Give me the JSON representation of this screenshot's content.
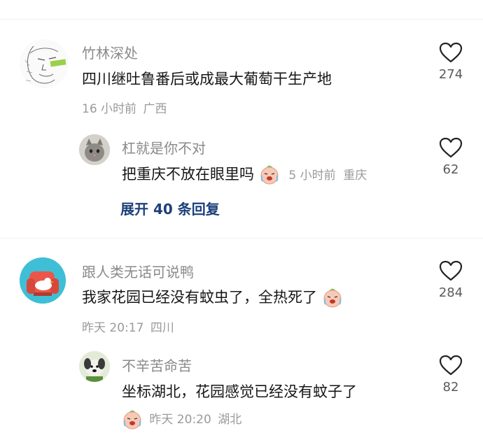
{
  "comments": [
    {
      "user": "竹林深处",
      "text": "四川继吐鲁番后或成最大葡萄干生产地",
      "time": "16 小时前",
      "location": "广西",
      "likes": "274",
      "avatar": "sketch-face-avatar",
      "reply": {
        "user": "杠就是你不对",
        "text": "把重庆不放在眼里吗",
        "emoji": "crying-face-emoji",
        "time": "5 小时前",
        "location": "重庆",
        "likes": "62",
        "avatar": "cat-avatar"
      },
      "expand_label": "展开 40 条回复"
    },
    {
      "user": "跟人类无话可说鸭",
      "text": "我家花园已经没有蚊虫了，全热死了",
      "emoji": "crying-face-emoji",
      "time": "昨天 20:17",
      "location": "四川",
      "likes": "284",
      "avatar": "duck-on-armchair-avatar",
      "reply": {
        "user": "不辛苦命苦",
        "text": "坐标湖北，花园感觉已经没有蚊子了",
        "emoji": "crying-face-emoji",
        "time": "昨天 20:20",
        "location": "湖北",
        "likes": "82",
        "avatar": "dog-avatar"
      }
    }
  ],
  "colors": {
    "text": "#161616",
    "username": "#8a8a8a",
    "meta": "#9a9a9a",
    "link": "#1d3f7a",
    "divider": "#f0f0f0"
  }
}
